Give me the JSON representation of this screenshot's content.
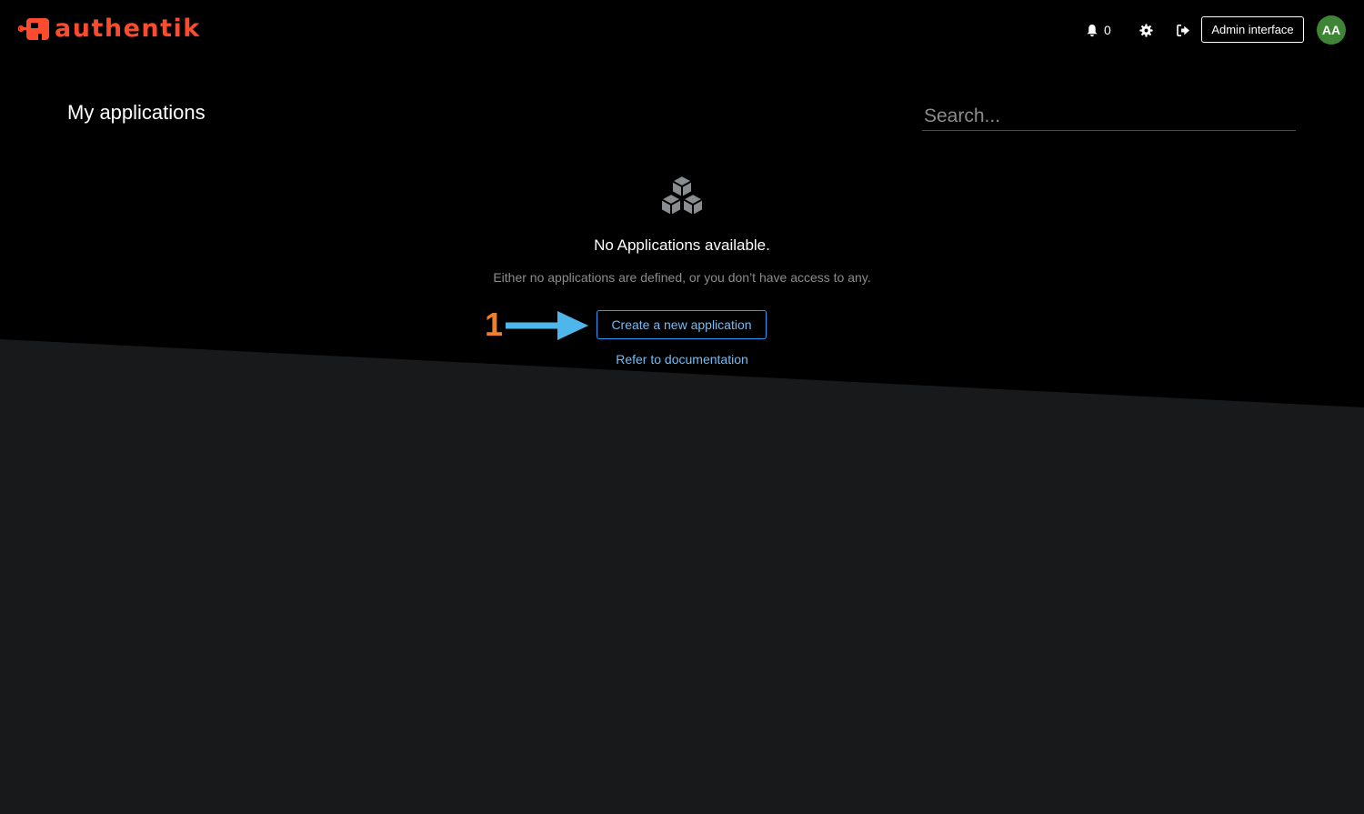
{
  "brand": {
    "name": "authentik",
    "color": "#fd4b2d"
  },
  "header": {
    "notification_icon": "bell-icon",
    "notification_count": "0",
    "settings_icon": "gear-icon",
    "logout_icon": "sign-out-icon",
    "admin_button_label": "Admin interface",
    "avatar_initials": "AA",
    "avatar_color": "#3e8635"
  },
  "main": {
    "title": "My applications",
    "search_placeholder": "Search...",
    "empty_state": {
      "icon": "cubes-icon",
      "title": "No Applications available.",
      "body": "Either no applications are defined, or you don’t have access to any.",
      "create_button_label": "Create a new application",
      "docs_link_label": "Refer to documentation"
    }
  },
  "annotation": {
    "number": "1",
    "number_color": "#f07e2a",
    "arrow_color": "#4fb6ec"
  },
  "colors": {
    "background_top": "#000000",
    "background_bottom": "#18191b",
    "link": "#73bcf7",
    "search_underline": "#c9190b"
  }
}
